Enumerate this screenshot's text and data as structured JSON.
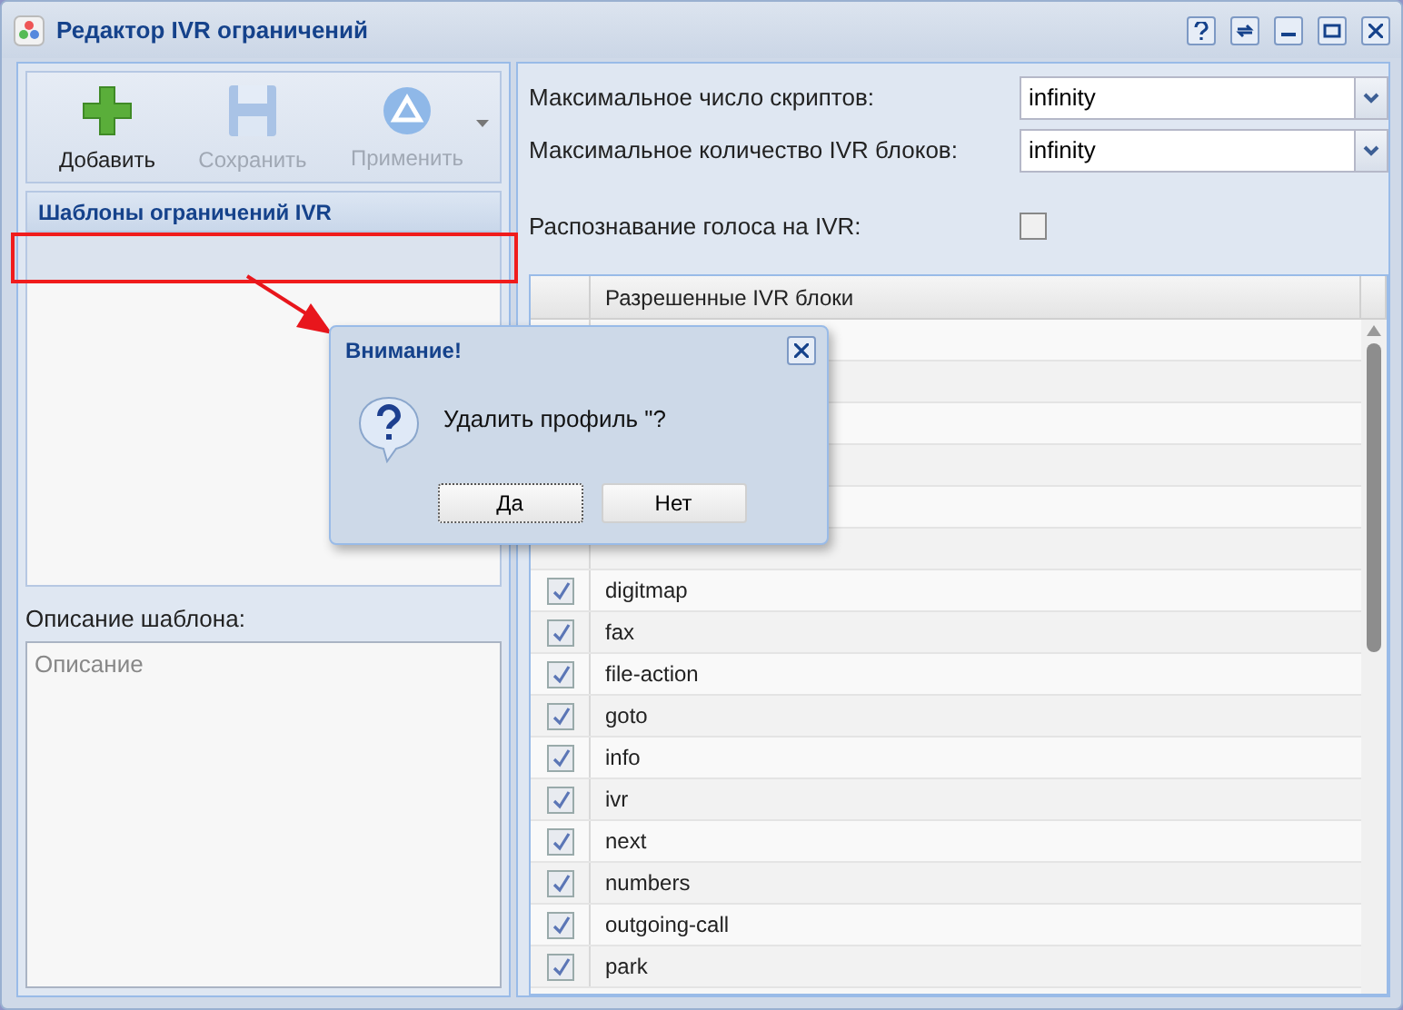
{
  "window": {
    "title": "Редактор IVR ограничений"
  },
  "toolbar": [
    {
      "kind": "add",
      "label": "Добавить",
      "disabled": false,
      "has_menu": false
    },
    {
      "kind": "save",
      "label": "Сохранить",
      "disabled": true,
      "has_menu": false
    },
    {
      "kind": "apply",
      "label": "Применить",
      "disabled": true,
      "has_menu": true
    }
  ],
  "templates": {
    "title": "Шаблоны ограничений IVR"
  },
  "description": {
    "label": "Описание шаблона:",
    "placeholder": "Описание"
  },
  "settings": [
    {
      "kind": "select",
      "label": "Максимальное число скриптов:",
      "value": "infinity"
    },
    {
      "kind": "select",
      "label": "Максимальное количество IVR блоков:",
      "value": "infinity"
    },
    {
      "kind": "checkbox",
      "label": "Распознавание голоса на IVR:",
      "checked": false
    }
  ],
  "grid": {
    "column": "Разрешенные IVR блоки",
    "rows": [
      {
        "name": "digitmap",
        "checked": true
      },
      {
        "name": "fax",
        "checked": true
      },
      {
        "name": "file-action",
        "checked": true
      },
      {
        "name": "goto",
        "checked": true
      },
      {
        "name": "info",
        "checked": true
      },
      {
        "name": "ivr",
        "checked": true
      },
      {
        "name": "next",
        "checked": true
      },
      {
        "name": "numbers",
        "checked": true
      },
      {
        "name": "outgoing-call",
        "checked": true
      },
      {
        "name": "park",
        "checked": true
      }
    ]
  },
  "dialog": {
    "title": "Внимание!",
    "message": "Удалить профиль \"?",
    "buttons": [
      {
        "label": "Да",
        "focused": true
      },
      {
        "label": "Нет",
        "focused": false
      }
    ]
  }
}
